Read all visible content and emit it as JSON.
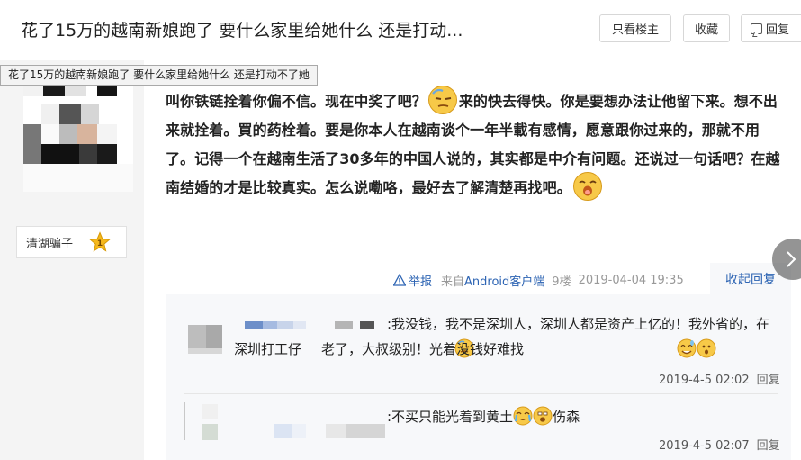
{
  "header": {
    "title": "花了15万的越南新娘跑了 要什么家里给她什么 还是打动...",
    "buttons": {
      "only_op": "只看楼主",
      "favorite": "收藏",
      "reply": "回复"
    }
  },
  "tooltip": "花了15万的越南新娘跑了 要什么家里给她什么 还是打动不了她",
  "author": {
    "name": "清湖骗子",
    "level": "1"
  },
  "post": {
    "segments": [
      "叫你铁链拴着你偏不信。现在中奖了吧？",
      "来的快去得快。你是要想办法让他留下来。想不出来就拴着。買的药栓着。要是你本人在越南谈个一年半載有感情，愿意跟你过来的，那就不用了。记得一个在越南生活了30多年的中国人说的，其实都是中介有问题。还说过一句话吧？在越南结婚的才是比较真实。怎么说嘞咯，最好去了解清楚再找吧。"
    ],
    "emojis": [
      "smug-emoji",
      "yawn-emoji"
    ],
    "meta": {
      "report": "举报",
      "from": "来自",
      "client": "Android客户端",
      "floor": "9楼",
      "time": "2019-04-04 19:35",
      "collapse": "收起回复"
    }
  },
  "replies": [
    {
      "text_parts": [
        ":我没钱，我不是深圳人，深圳人都是资产上亿的！我外省的，在深圳打工仔",
        "老了，大叔级别！光着没钱好难找"
      ],
      "time": "2019-4-5 02:02",
      "reply_label": "回复"
    },
    {
      "text_parts": [
        ":不买只能光着到黄土",
        "伤森"
      ],
      "time": "2019-4-5 02:07",
      "reply_label": "回复"
    }
  ],
  "colors": {
    "link": "#2d64b3",
    "sidebar_bg": "#f4f4f4",
    "reply_bg": "#f7f8fa",
    "star": "#f5b81c"
  }
}
